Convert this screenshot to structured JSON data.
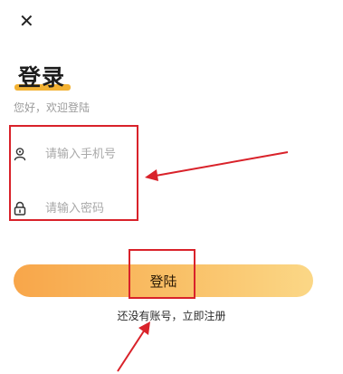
{
  "header": {
    "close_icon": "close-icon"
  },
  "title": "登录",
  "subtitle": "您好，欢迎登陆",
  "phone_field": {
    "icon": "user-icon",
    "placeholder": "请输入手机号",
    "value": ""
  },
  "password_field": {
    "icon": "lock-icon",
    "placeholder": "请输入密码",
    "value": ""
  },
  "login_button": {
    "label": "登陆",
    "gradient": [
      "#f8a64a",
      "#fbd786"
    ]
  },
  "register_link": "还没有账号，立即注册",
  "colors": {
    "accent": "#f3b233",
    "annotation": "#d9222a"
  }
}
